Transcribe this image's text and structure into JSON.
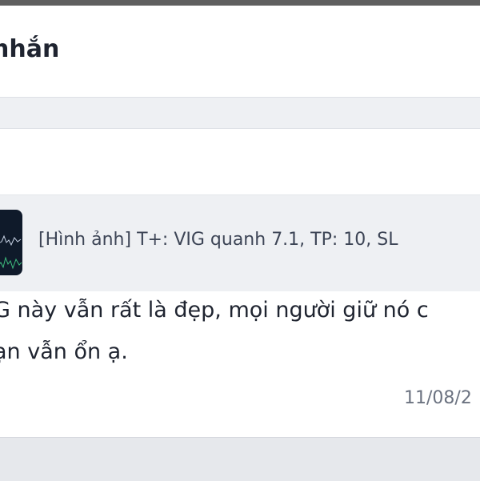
{
  "header": {
    "title": "nhắn"
  },
  "quoted": {
    "text": "[Hình ảnh] T+: VIG quanh 7.1, TP: 10, SL"
  },
  "message": {
    "line1": "G này vẫn rất là đẹp, mọi người giữ nó c",
    "line2": "ạn vẫn ổn ạ.",
    "timestamp": "11/08/2"
  },
  "colors": {
    "quote_background": "#eef0f3",
    "thumbnail_background": "#0f1a2a",
    "timestamp": "#6b7280"
  },
  "icons": {
    "thumbnail": "chart-thumbnail-image"
  }
}
